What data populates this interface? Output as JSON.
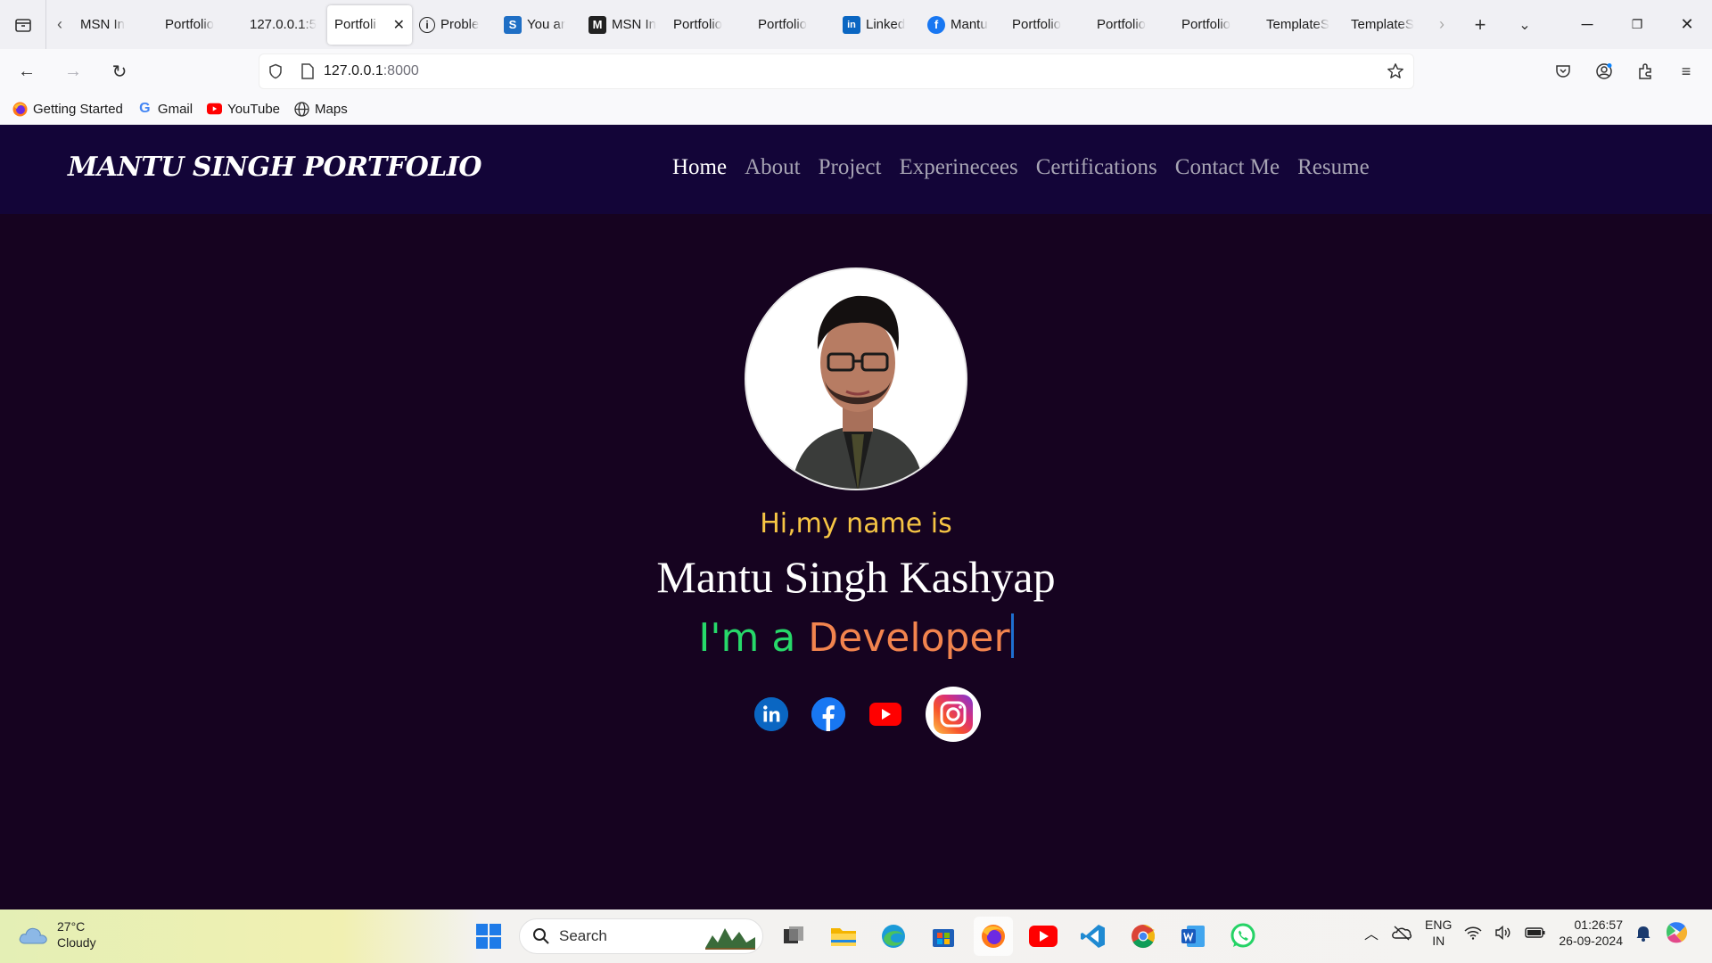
{
  "browser": {
    "tabs": [
      {
        "label": "MSN In",
        "icon": "msn-icon"
      },
      {
        "label": "Portfolio",
        "icon": "none"
      },
      {
        "label": "127.0.0.1:5",
        "icon": "none"
      },
      {
        "label": "Portfoli",
        "icon": "none",
        "active": true
      },
      {
        "label": "Proble",
        "icon": "info-icon"
      },
      {
        "label": "You ar",
        "icon": "s-icon"
      },
      {
        "label": "MSN In",
        "icon": "msn-icon"
      },
      {
        "label": "Portfolio",
        "icon": "none"
      },
      {
        "label": "Portfolio",
        "icon": "none"
      },
      {
        "label": "Linked",
        "icon": "linkedin-icon"
      },
      {
        "label": "Mantu",
        "icon": "facebook-icon"
      },
      {
        "label": "Portfolio",
        "icon": "none"
      },
      {
        "label": "Portfolio",
        "icon": "none"
      },
      {
        "label": "Portfolio",
        "icon": "none"
      },
      {
        "label": "TemplateS",
        "icon": "none"
      },
      {
        "label": "TemplateS",
        "icon": "none"
      }
    ],
    "url_host": "127.0.0.1",
    "url_port": ":8000",
    "bookmarks": [
      {
        "label": "Getting Started",
        "icon": "firefox-icon"
      },
      {
        "label": "Gmail",
        "icon": "google-icon"
      },
      {
        "label": "YouTube",
        "icon": "youtube-icon"
      },
      {
        "label": "Maps",
        "icon": "globe-icon"
      }
    ]
  },
  "site": {
    "logo": "MANTU SINGH PORTFOLIO",
    "nav": [
      {
        "label": "Home",
        "active": true
      },
      {
        "label": "About"
      },
      {
        "label": "Project"
      },
      {
        "label": "Experinecees"
      },
      {
        "label": "Certifications"
      },
      {
        "label": "Contact Me"
      },
      {
        "label": "Resume"
      }
    ],
    "hero": {
      "greeting": "Hi,my name is",
      "name": "Mantu Singh Kashyap",
      "role_prefix": "I'm a",
      "role_word": "Developer"
    },
    "socials": [
      "linkedin-icon",
      "facebook-icon",
      "youtube-icon",
      "instagram-icon"
    ],
    "colors": {
      "header_bg": "#130538",
      "page_bg": "#160320",
      "greeting": "#f6c544",
      "role_prefix": "#27d96a",
      "role_word": "#f2844e"
    }
  },
  "taskbar": {
    "weather_temp": "27°C",
    "weather_desc": "Cloudy",
    "search_placeholder": "Search",
    "lang_1": "ENG",
    "lang_2": "IN",
    "time": "01:26:57",
    "date": "26-09-2024"
  }
}
